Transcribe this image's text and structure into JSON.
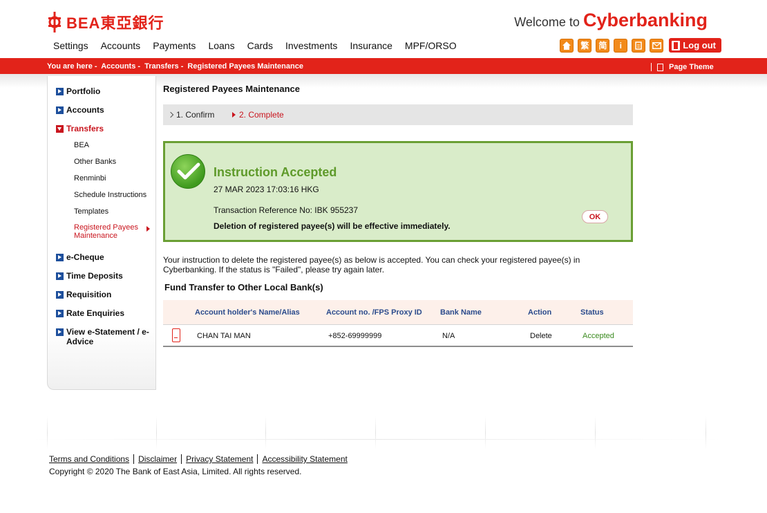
{
  "header": {
    "logo_text": "BEA東亞銀行",
    "welcome_prefix": "Welcome to",
    "welcome_brand": "Cyberbanking",
    "nav": [
      "Settings",
      "Accounts",
      "Payments",
      "Loans",
      "Cards",
      "Investments",
      "Insurance",
      "MPF/ORSO"
    ],
    "tools": {
      "trad_chinese": "繁",
      "simp_chinese": "简",
      "info": "i"
    },
    "logout_label": "Log out"
  },
  "breadcrumb": {
    "prefix": "You are here -",
    "items": [
      "Accounts -",
      "Transfers -",
      "Registered Payees Maintenance"
    ],
    "page_theme": "Page Theme"
  },
  "sidebar": {
    "items": [
      {
        "label": "Portfolio"
      },
      {
        "label": "Accounts"
      },
      {
        "label": "Transfers"
      },
      {
        "label": "e-Cheque"
      },
      {
        "label": "Time Deposits"
      },
      {
        "label": "Requisition"
      },
      {
        "label": "Rate Enquiries"
      },
      {
        "label": "View e-Statement / e-Advice"
      }
    ],
    "subitems": [
      {
        "label": "BEA"
      },
      {
        "label": "Other Banks"
      },
      {
        "label": "Renminbi"
      },
      {
        "label": "Schedule Instructions"
      },
      {
        "label": "Templates"
      },
      {
        "label": "Registered Payees Maintenance"
      }
    ]
  },
  "main": {
    "title": "Registered Payees Maintenance",
    "steps": [
      "1. Confirm",
      "2. Complete"
    ],
    "result": {
      "heading": "Instruction Accepted",
      "datetime": "27 MAR 2023 17:03:16 HKG",
      "reference": "Transaction Reference No: IBK 955237",
      "note": "Deletion of registered payee(s) will be effective immediately.",
      "ok_label": "OK"
    },
    "description": "Your instruction to delete the registered payee(s) as below is accepted. You can check your registered payee(s) in Cyberbanking. If the status is \"Failed\", please try again later.",
    "section_title": "Fund Transfer to Other Local Bank(s)",
    "table": {
      "headers": [
        "Account holder's Name/Alias",
        "Account no. /FPS Proxy ID",
        "Bank Name",
        "Action",
        "Status"
      ],
      "rows": [
        {
          "name": "CHAN TAI MAN",
          "account": "+852-69999999",
          "bank": "N/A",
          "action": "Delete",
          "status": "Accepted"
        }
      ]
    }
  },
  "footer": {
    "links": [
      "Terms and Conditions",
      "Disclaimer",
      "Privacy Statement",
      "Accessibility Statement"
    ],
    "copyright": "Copyright © 2020 The Bank of East Asia, Limited. All rights reserved."
  },
  "colors": {
    "brand_red": "#e2231a",
    "success_green": "#6a9f34",
    "link_blue": "#2b4b8c",
    "tool_orange": "#f28a1a"
  }
}
